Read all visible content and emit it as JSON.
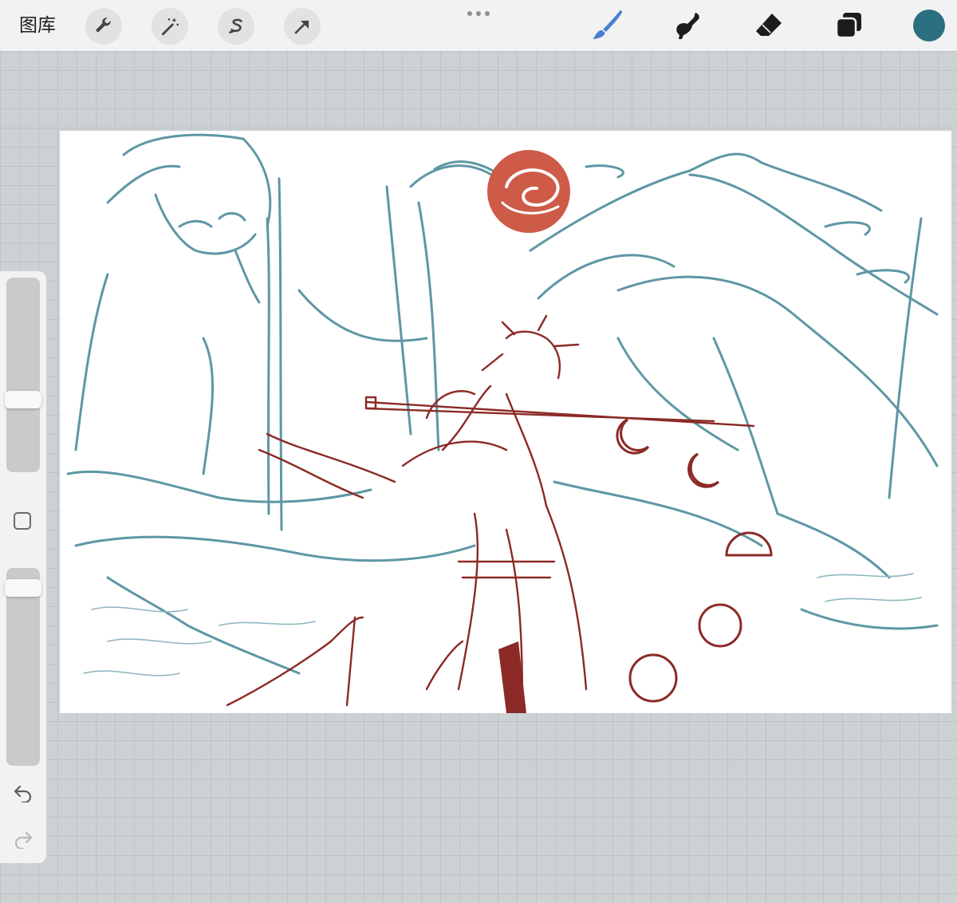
{
  "toolbar": {
    "gallery_label": "图库",
    "left_tools": [
      "wrench-icon",
      "magic-wand-icon",
      "selection-icon",
      "arrow-transform-icon"
    ],
    "right_tools": [
      "brush-icon",
      "smudge-icon",
      "eraser-icon",
      "layers-icon"
    ],
    "active_tool": "brush-icon",
    "brush_color": "#4a7fd0",
    "current_color": "#2b6f80"
  },
  "sidebar": {
    "brush_size_level": 0.36,
    "opacity_level": 0.94,
    "tools": [
      "modify-square-icon",
      "undo-icon",
      "redo-icon"
    ]
  },
  "canvas": {
    "line_colors": {
      "teal_layer": "#5e97a4",
      "red_layer": "#8b2a26",
      "sun": "#cd5b48"
    }
  }
}
